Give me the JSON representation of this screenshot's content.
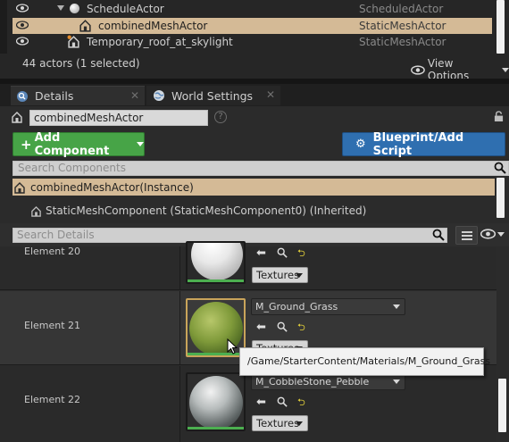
{
  "outliner": {
    "rows": [
      {
        "name": "ScheduleActor",
        "type": "ScheduledActor",
        "selected": false
      },
      {
        "name": "combinedMeshActor",
        "type": "StaticMeshActor",
        "selected": true
      },
      {
        "name": "Temporary_roof_at_skylight",
        "type": "StaticMeshActor",
        "selected": false
      }
    ],
    "status": "44 actors (1 selected)",
    "view_options": "View Options"
  },
  "tabs": [
    {
      "label": "Details"
    },
    {
      "label": "World Settings"
    }
  ],
  "details": {
    "actor_name": "combinedMeshActor",
    "add_component": "Add Component",
    "blueprint_button": "Blueprint/Add Script",
    "search_components_placeholder": "Search Components",
    "components": [
      {
        "label": "combinedMeshActor(Instance)",
        "selected": true
      },
      {
        "label": "StaticMeshComponent (StaticMeshComponent0) (Inherited)",
        "selected": false
      }
    ],
    "search_details_placeholder": "Search Details",
    "elements": [
      {
        "label": "Element 20",
        "material": "",
        "textures_label": "Textures"
      },
      {
        "label": "Element 21",
        "material": "M_Ground_Grass",
        "textures_label": "Textures"
      },
      {
        "label": "Element 22",
        "material": "M_CobbleStone_Pebble",
        "textures_label": "Textures"
      }
    ],
    "tooltip": "/Game/StarterContent/Materials/M_Ground_Grass"
  },
  "colors": {
    "selected_row": "#d4ba96",
    "add_component": "#47a447",
    "blueprint": "#2f6fb0",
    "thumb_bar": "#4caf50"
  }
}
